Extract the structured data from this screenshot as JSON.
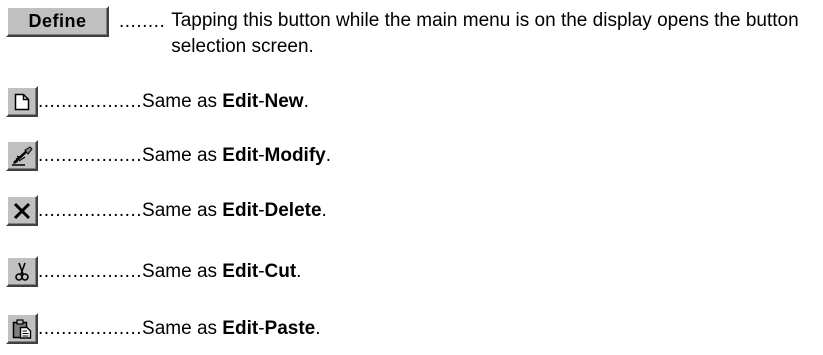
{
  "define_row": {
    "button_label": "Define",
    "leader": "........",
    "description": "Tapping this button while the main menu is on the display opens the button selection screen."
  },
  "rows": [
    {
      "icon": "new-document-icon",
      "leader": "..................",
      "prefix": "Same as ",
      "menu": "Edit",
      "sep": "-",
      "item": "New",
      "end": "."
    },
    {
      "icon": "modify-pen-icon",
      "leader": "..................",
      "prefix": "Same as ",
      "menu": "Edit",
      "sep": "-",
      "item": "Modify",
      "end": "."
    },
    {
      "icon": "delete-x-icon",
      "leader": "..................",
      "prefix": "Same as ",
      "menu": "Edit",
      "sep": "-",
      "item": "Delete",
      "end": "."
    },
    {
      "icon": "scissors-cut-icon",
      "leader": "..................",
      "prefix": "Same as ",
      "menu": "Edit",
      "sep": "-",
      "item": "Cut",
      "end": "."
    },
    {
      "icon": "clipboard-paste-icon",
      "leader": "..................",
      "prefix": "Same as ",
      "menu": "Edit",
      "sep": "-",
      "item": "Paste",
      "end": "."
    }
  ]
}
